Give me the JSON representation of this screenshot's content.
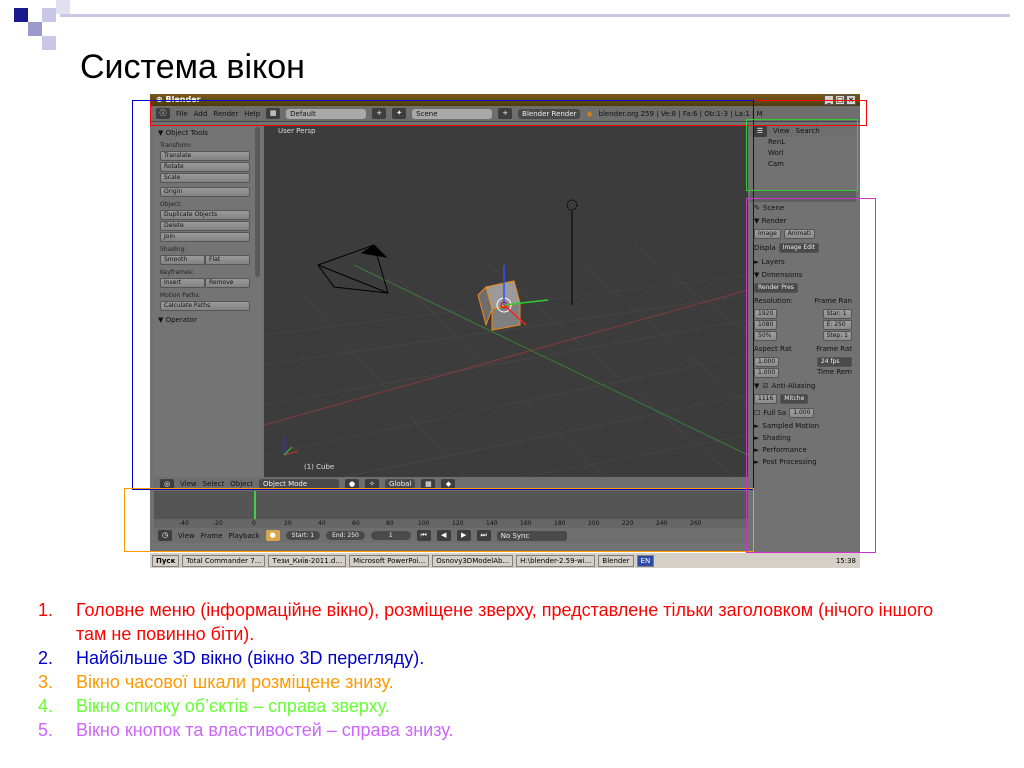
{
  "slide": {
    "title": "Система вікон"
  },
  "blender": {
    "window_title": "Blender",
    "menubar": {
      "items": [
        "File",
        "Add",
        "Render",
        "Help"
      ],
      "layout": "Default",
      "scene": "Scene",
      "engine": "Blender Render",
      "info": "blender.org 259 | Ve:8 | Fa:6 | Ob:1-3 | La:1 | M"
    },
    "toolbar": {
      "header": "▼ Object Tools",
      "transform_label": "Transform:",
      "translate": "Translate",
      "rotate": "Rotate",
      "scale": "Scale",
      "origin": "Origin",
      "object_label": "Object:",
      "duplicate": "Duplicate Objects",
      "delete": "Delete",
      "join": "Join",
      "shading_label": "Shading:",
      "smooth": "Smooth",
      "flat": "Flat",
      "keyframes_label": "Keyframes:",
      "insert": "Insert",
      "remove": "Remove",
      "motion_label": "Motion Paths:",
      "calc_paths": "Calculate Paths",
      "operator": "▼ Operator"
    },
    "viewport": {
      "label": "User Persp",
      "selected": "(1) Cube",
      "header": {
        "view": "View",
        "select": "Select",
        "object": "Object",
        "mode": "Object Mode",
        "orientation": "Global"
      }
    },
    "timeline": {
      "ruler": [
        "-40",
        "-20",
        "0",
        "20",
        "40",
        "60",
        "80",
        "100",
        "120",
        "140",
        "160",
        "180",
        "200",
        "220",
        "240",
        "260"
      ],
      "view": "View",
      "frame": "Frame",
      "playback": "Playback",
      "start": "Start: 1",
      "end": "End: 250",
      "current": "1",
      "sync": "No Sync"
    },
    "outliner": {
      "view": "View",
      "search": "Search",
      "items": [
        "RenL",
        "Worl",
        "Cam"
      ]
    },
    "properties": {
      "scene": "Scene",
      "render": "▼ Render",
      "image": "Image",
      "animation": "Animati",
      "display_label": "Displa",
      "display_value": "Image Edit",
      "layers": "► Layers",
      "dimensions": "▼ Dimensions",
      "preset": "Render Pres",
      "resolution": "Resolution:",
      "frame_range": "Frame Ran",
      "res_x": "1920",
      "res_y": "1080",
      "res_pct": "50%",
      "start": "Star: 1",
      "end": "E: 250",
      "step": "Step: 1",
      "aspect": "Aspect Rat",
      "frame_rate": "Frame Rat",
      "aspect_x": "1.000",
      "aspect_y": "1.000",
      "fps": "24 fps",
      "time_rem": "Time Rem",
      "aa": "Anti-Aliasing",
      "aa_samples": "1116",
      "aa_filter": "Mitche",
      "full_sample": "Full Sa",
      "aa_size": "1.000",
      "sampled_motion": "Sampled Motion",
      "shading": "Shading",
      "performance": "Performance",
      "post_processing": "Post Processing"
    },
    "taskbar": {
      "start": "Пуск",
      "items": [
        "Total Commander 7...",
        "Тези_Київ-2011.d...",
        "Microsoft PowerPoi...",
        "Osnovy3DModelAb...",
        "H:\\blender-2.59-wi...",
        "Blender"
      ],
      "lang": "EN",
      "clock": "15:38"
    }
  },
  "notes": [
    {
      "num": "1.",
      "text": "Головне меню (інформаційне вікно), розміщене зверху, представлене тільки заголовком (нічого іншого там не повинно біти).",
      "color": "#ff0000"
    },
    {
      "num": "2.",
      "text": "Найбільше 3D вікно (вікно 3D перегляду).",
      "color": "#0000cc"
    },
    {
      "num": "3.",
      "text": "Вікно часової шкали розміщене знизу.",
      "color": "#ff9900"
    },
    {
      "num": "4.",
      "text": "Вікно списку об’єктів – справа зверху.",
      "color": "#66ff33"
    },
    {
      "num": "5.",
      "text": "Вікно кнопок та властивостей – справа знизу.",
      "color": "#cc66ff"
    }
  ],
  "colors": {
    "highlight_menu": "#ff0000",
    "highlight_3d": "#0000cc",
    "highlight_timeline": "#ff9900",
    "highlight_outliner": "#33cc33",
    "highlight_props": "#cc33cc"
  }
}
